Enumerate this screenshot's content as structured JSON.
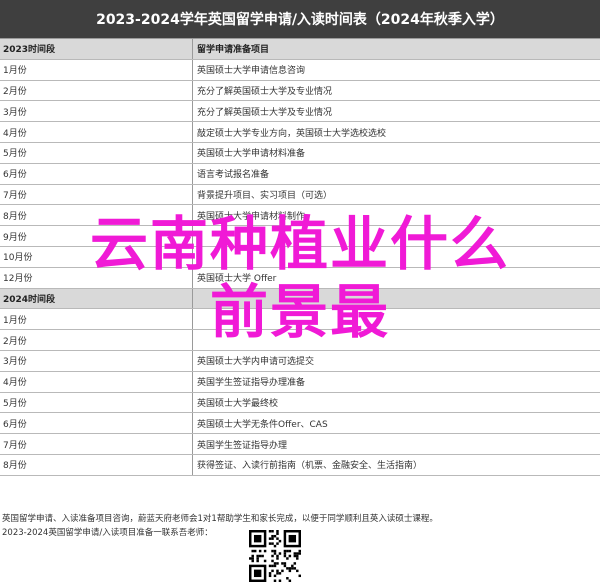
{
  "title": "2023-2024学年英国留学申请/入读时间表（2024年秋季入学）",
  "section_2023": {
    "header_left": "2023时间段",
    "header_right": "留学申请准备项目",
    "rows": [
      {
        "time": "1月份",
        "item": "英国硕士大学申请信息咨询"
      },
      {
        "time": "2月份",
        "item": "充分了解英国硕士大学及专业情况"
      },
      {
        "time": "3月份",
        "item": "充分了解英国硕士大学及专业情况"
      },
      {
        "time": "4月份",
        "item": "敲定硕士大学专业方向，英国硕士大学选校选校"
      },
      {
        "time": "5月份",
        "item": "英国硕士大学申请材料准备"
      },
      {
        "time": "6月份",
        "item": "语言考试报名准备"
      },
      {
        "time": "7月份",
        "item": "背景提升项目、实习项目（可选）"
      },
      {
        "time": "8月份",
        "item": "英国硕士大学申请材料制作"
      },
      {
        "time": "9月份",
        "item": ""
      },
      {
        "time": "10月份",
        "item": ""
      },
      {
        "time": "12月份",
        "item": "英国硕士大学 Offer"
      }
    ]
  },
  "section_2024": {
    "header_left": "2024时间段",
    "header_right": "",
    "rows": [
      {
        "time": "1月份",
        "item": ""
      },
      {
        "time": "2月份",
        "item": ""
      },
      {
        "time": "3月份",
        "item": "英国硕士大学内申请可选提交"
      },
      {
        "time": "4月份",
        "item": "英国学生签证指导办理准备"
      },
      {
        "time": "5月份",
        "item": "英国硕士大学最终校"
      },
      {
        "time": "6月份",
        "item": "英国硕士大学无条件Offer、CAS"
      },
      {
        "time": "7月份",
        "item": "英国学生签证指导办理"
      },
      {
        "time": "8月份",
        "item": "获得签证、入读行前指南（机票、金融安全、生活指南）"
      }
    ]
  },
  "footer": {
    "line1": "英国留学申请、入读准备项目咨询，蔚蓝天府老师会1对1帮助学生和家长完成，以便于同学顺利且英入读硕士课程。",
    "line2": "2023-2024英国留学申请/入读项目准备一联系吾老师："
  },
  "overlay": {
    "line1": "云南种植业什么",
    "line2": "前景最"
  },
  "colors": {
    "title_bg": "#3f3f3f",
    "header_bg": "#d9d9d9",
    "overlay_text": "#f01ad6"
  }
}
